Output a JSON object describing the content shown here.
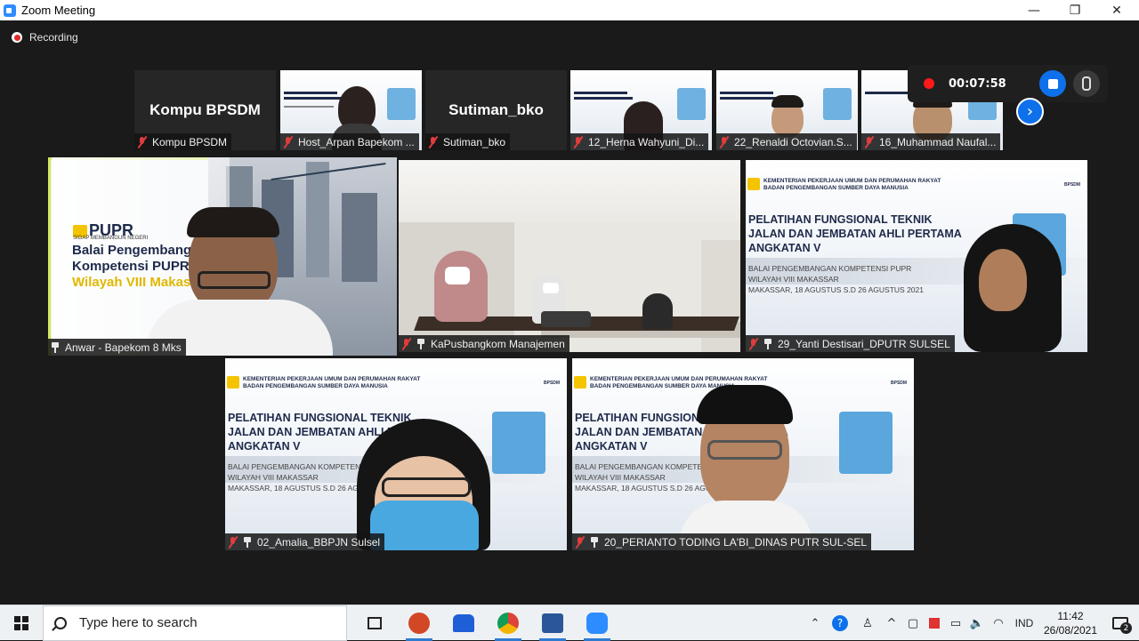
{
  "window": {
    "title": "Zoom Meeting",
    "minimize": "—",
    "maximize": "❐",
    "close": "✕"
  },
  "recording": {
    "label": "Recording"
  },
  "meeting_controls": {
    "timer": "00:07:58"
  },
  "strip": [
    {
      "bigname": "Kompu BPSDM",
      "label": "Kompu BPSDM",
      "video": false
    },
    {
      "bigname": "",
      "label": "Host_Arpan Bapekom ...",
      "video": true
    },
    {
      "bigname": "Sutiman_bko",
      "label": "Sutiman_bko",
      "video": false
    },
    {
      "bigname": "",
      "label": "12_Herna Wahyuni_Di...",
      "video": true
    },
    {
      "bigname": "",
      "label": "22_Renaldi Octovian.S...",
      "video": true
    },
    {
      "bigname": "",
      "label": "16_Muhammad Naufal...",
      "video": true
    }
  ],
  "main_tiles": [
    {
      "label": "Anwar - Bapekom 8 Mks",
      "pupr": "PUPR",
      "tagline": "SIGAP MEMBANGUN NEGERI",
      "line1": "Balai Pengembangan",
      "line2": "Kompetensi PUPR",
      "line3": "Wilayah VIII Makassar"
    },
    {
      "label": "KaPusbangkom Manajemen"
    },
    {
      "label": "29_Yanti Destisari_DPUTR SULSEL"
    },
    {
      "label": "02_Amalia_BBPJN Sulsel"
    },
    {
      "label": "20_PERIANTO TODING LA'BI_DINAS PUTR SUL-SEL"
    }
  ],
  "slide": {
    "ministry1": "KEMENTERIAN PEKERJAAN UMUM DAN PERUMAHAN RAKYAT",
    "ministry2": "BADAN PENGEMBANGAN SUMBER DAYA MANUSIA",
    "logo_text": "BPSDM",
    "title1": "PELATIHAN FUNGSIONAL TEKNIK",
    "title2": "JALAN DAN JEMBATAN AHLI PERTAMA",
    "title3": "ANGKATAN  V",
    "sub1": "BALAI PENGEMBANGAN KOMPETENSI PUPR",
    "sub2": "WILAYAH VIII MAKASSAR",
    "sub3": "MAKASSAR, 18 AGUSTUS S.D 26 AGUSTUS 2021"
  },
  "taskbar": {
    "search_placeholder": "Type here to search",
    "language": "IND",
    "time": "11:42",
    "date": "26/08/2021",
    "notifications": "2"
  },
  "colors": {
    "accent": "#0e71eb",
    "active_speaker": "#d3e85a",
    "muted": "#e03c3c"
  }
}
